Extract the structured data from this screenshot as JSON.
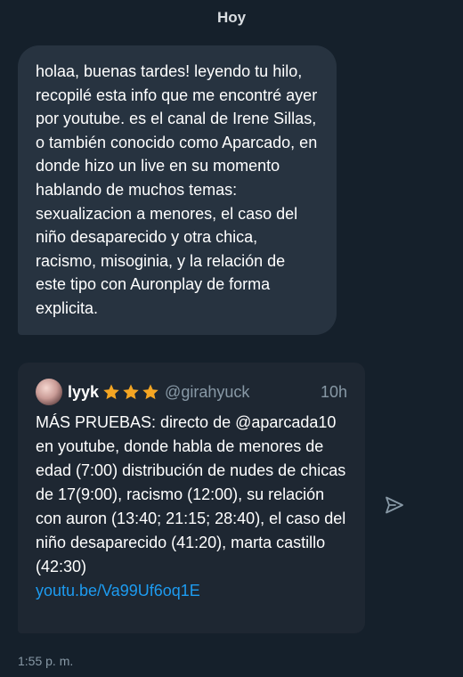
{
  "day_header": "Hoy",
  "message": {
    "text": "holaa, buenas tardes! leyendo tu hilo, recopilé esta info que me encontré ayer por youtube. es el canal de Irene Sillas, o también conocido como Aparcado, en donde hizo un live en su momento hablando de muchos temas: sexualizacion a menores, el caso del niño desaparecido y otra chica, racismo, misoginia, y la relación de este tipo con Auronplay de forma explicita."
  },
  "tweet": {
    "author_name": "lyyk",
    "author_badges": [
      "star-icon",
      "star-icon",
      "star-icon"
    ],
    "author_handle": "@girahyuck",
    "time": "10h",
    "text": "MÁS PRUEBAS: directo de @aparcada10 en youtube, donde habla de menores de edad (7:00) distribución de nudes de chicas de 17(9:00), racismo (12:00), su relación con auron (13:40; 21:15; 28:40), el caso del niño desaparecido (41:20), marta castillo (42:30)",
    "link": "youtu.be/Va99Uf6oq1E"
  },
  "share_icon": "send-icon",
  "timestamp": "1:55 p. m.",
  "colors": {
    "background": "#15202b",
    "bubble": "#273340",
    "card": "#1e2732",
    "link": "#1d9bf0",
    "muted": "#8899a6",
    "star": "#f5a623"
  }
}
